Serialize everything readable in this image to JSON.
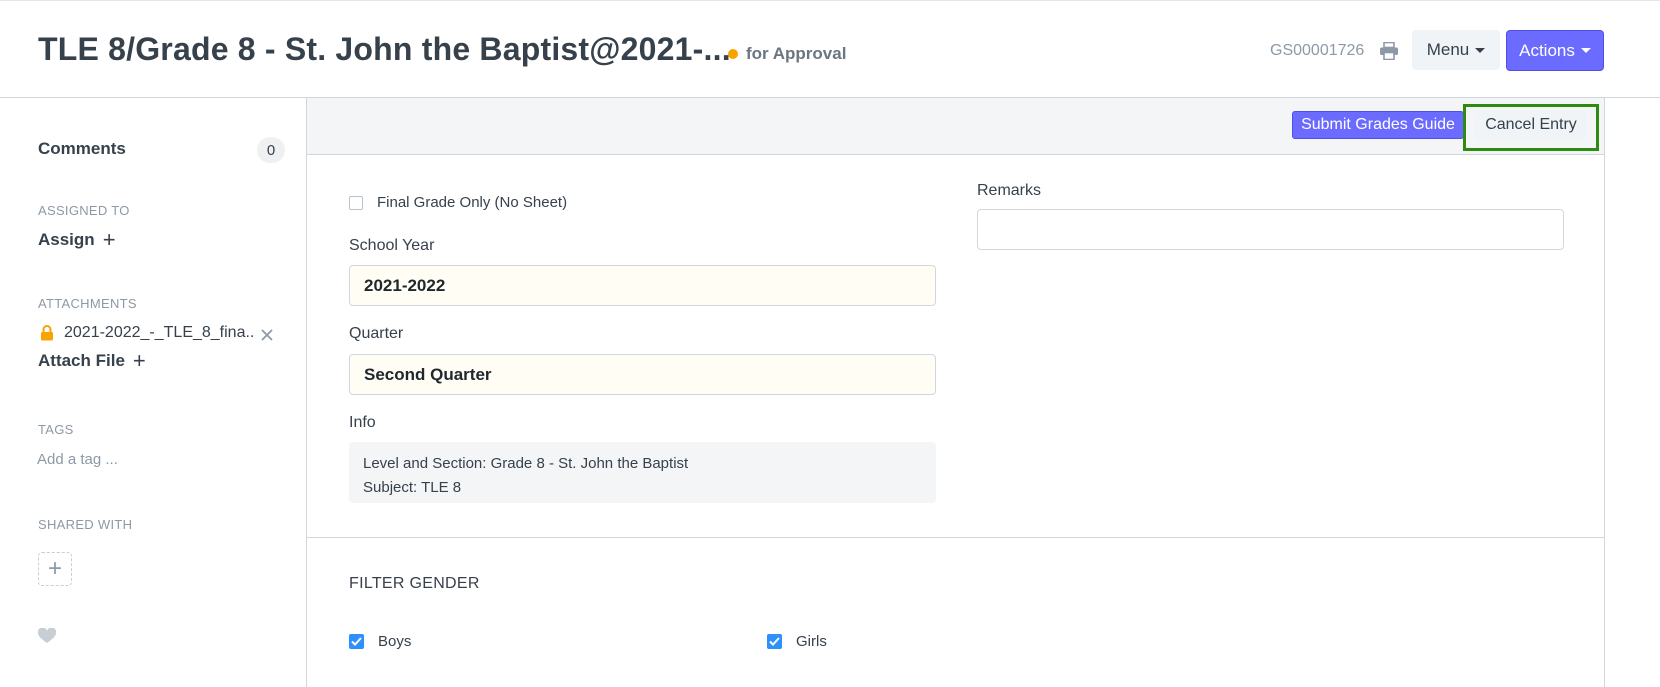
{
  "header": {
    "title": "TLE 8/Grade 8 - St. John the Baptist@2021-...",
    "status": "for Approval",
    "doc_id": "GS00001726",
    "menu_label": "Menu",
    "actions_label": "Actions"
  },
  "sidebar": {
    "comments_label": "Comments",
    "comments_count": "0",
    "assigned_to_title": "ASSIGNED TO",
    "assign_label": "Assign",
    "attachments_title": "ATTACHMENTS",
    "attachment_name": "2021-2022_-_TLE_8_fina...",
    "attach_file_label": "Attach File",
    "tags_title": "TAGS",
    "add_tag_placeholder": "Add a tag ...",
    "shared_with_title": "SHARED WITH"
  },
  "toolbar": {
    "submit_label": "Submit Grades Guide",
    "cancel_label": "Cancel Entry"
  },
  "form": {
    "final_grade_only_label": "Final Grade Only (No Sheet)",
    "school_year_label": "School Year",
    "school_year_value": "2021-2022",
    "quarter_label": "Quarter",
    "quarter_value": "Second Quarter",
    "info_label": "Info",
    "info_line1": "Level and Section: Grade 8 - St. John the Baptist",
    "info_line2": "Subject: TLE 8",
    "remarks_label": "Remarks",
    "remarks_value": ""
  },
  "filter_gender": {
    "title": "FILTER GENDER",
    "boys_label": "Boys",
    "girls_label": "Girls"
  },
  "colors": {
    "primary": "#6b6bff",
    "status_dot": "#f8a400",
    "highlight": "#2e8b11",
    "checkbox": "#2e90fa"
  },
  "icons": {
    "print": "printer-icon",
    "lock": "lock-icon",
    "remove": "close-icon",
    "heart": "heart-icon"
  }
}
